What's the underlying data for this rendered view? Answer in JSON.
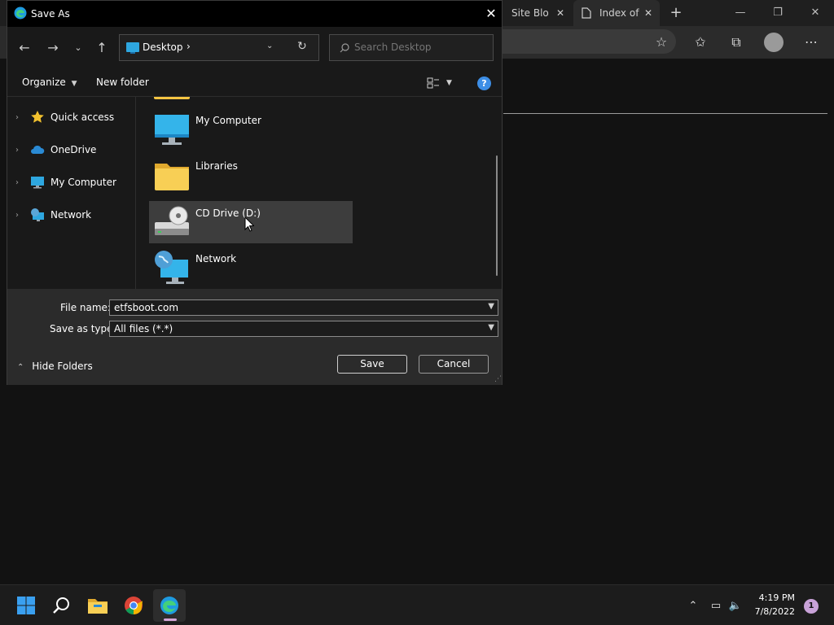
{
  "browser": {
    "tabs": [
      {
        "label": "Site Blo"
      },
      {
        "label": "Index of"
      }
    ],
    "new_tab_symbol": "+"
  },
  "dialog": {
    "title": "Save As",
    "path": {
      "location": "Desktop"
    },
    "search": {
      "placeholder": "Search Desktop"
    },
    "commands": {
      "organize": "Organize",
      "new_folder": "New folder"
    },
    "nav_pane": [
      {
        "label": "Quick access",
        "icon": "star-icon"
      },
      {
        "label": "OneDrive",
        "icon": "cloud-icon"
      },
      {
        "label": "My Computer",
        "icon": "monitor-icon"
      },
      {
        "label": "Network",
        "icon": "network-icon"
      }
    ],
    "files": [
      {
        "label": "My Computer",
        "icon": "monitor-icon"
      },
      {
        "label": "Libraries",
        "icon": "folder-icon"
      },
      {
        "label": "CD Drive (D:)",
        "icon": "cd-drive-icon",
        "selected": true
      },
      {
        "label": "Network",
        "icon": "network-icon"
      }
    ],
    "file_name": {
      "label": "File name:",
      "value": "etfsboot.com"
    },
    "save_as_type": {
      "label": "Save as type:",
      "value": "All files (*.*)"
    },
    "hide_folders": "Hide Folders",
    "save_label": "Save",
    "cancel_label": "Cancel"
  },
  "taskbar": {
    "time": "4:19 PM",
    "date": "7/8/2022",
    "notification_count": "1"
  },
  "colors": {
    "accent": "#3d8ee6",
    "selection": "#3d3d3d",
    "background": "#121212"
  }
}
